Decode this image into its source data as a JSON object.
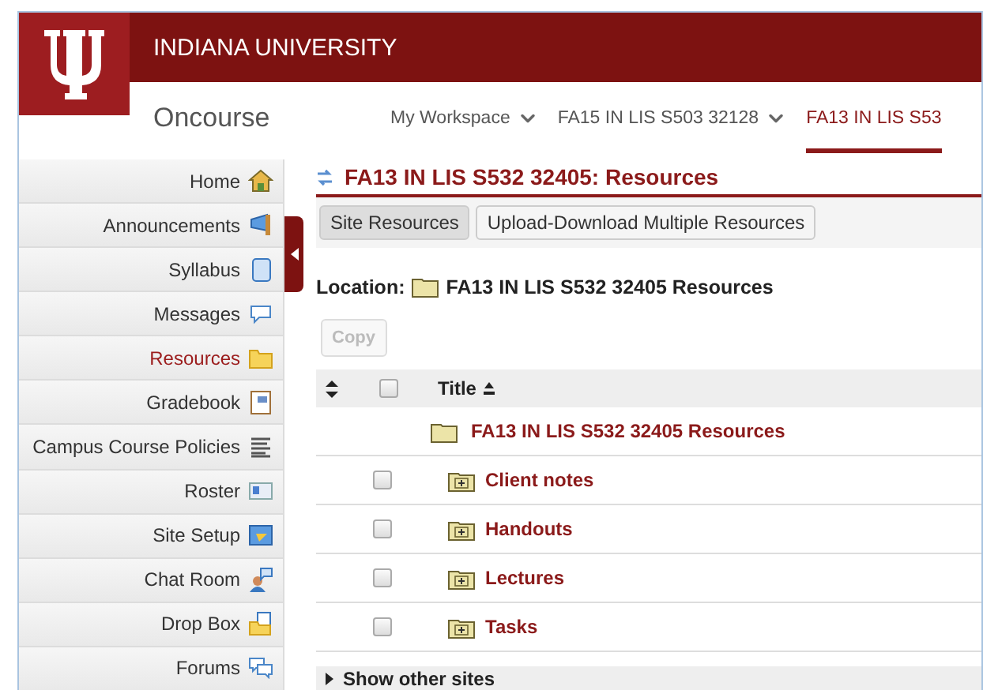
{
  "header": {
    "university": "INDIANA UNIVERSITY",
    "product": "Oncourse"
  },
  "tabs": [
    {
      "label": "My Workspace",
      "selected": false,
      "dropdown": true
    },
    {
      "label": "FA15 IN LIS S503 32128",
      "selected": false,
      "dropdown": true
    },
    {
      "label": "FA13 IN LIS S53",
      "selected": true,
      "dropdown": false
    }
  ],
  "sidebar": {
    "items": [
      {
        "label": "Home",
        "selected": false
      },
      {
        "label": "Announcements",
        "selected": false
      },
      {
        "label": "Syllabus",
        "selected": false
      },
      {
        "label": "Messages",
        "selected": false
      },
      {
        "label": "Resources",
        "selected": true
      },
      {
        "label": "Gradebook",
        "selected": false
      },
      {
        "label": "Campus Course Policies",
        "selected": false
      },
      {
        "label": "Roster",
        "selected": false
      },
      {
        "label": "Site Setup",
        "selected": false
      },
      {
        "label": "Chat Room",
        "selected": false
      },
      {
        "label": "Drop Box",
        "selected": false
      },
      {
        "label": "Forums",
        "selected": false
      }
    ]
  },
  "page_title": "FA13 IN LIS S532 32405: Resources",
  "toolbar": [
    {
      "label": "Site Resources",
      "selected": true
    },
    {
      "label": "Upload-Download Multiple Resources",
      "selected": false
    }
  ],
  "location": {
    "label": "Location:",
    "path": "FA13 IN LIS S532 32405 Resources"
  },
  "copy_button": {
    "label": "Copy",
    "disabled": true
  },
  "table": {
    "columns": [
      "Title"
    ],
    "select_all": {
      "checked": false
    },
    "root": {
      "title": "FA13 IN LIS S532 32405 Resources",
      "children": [
        {
          "title": "Client notes",
          "checked": false
        },
        {
          "title": "Handouts",
          "checked": false
        },
        {
          "title": "Lectures",
          "checked": false
        },
        {
          "title": "Tasks",
          "checked": false
        }
      ]
    }
  },
  "footer": {
    "label": "Show other sites",
    "expanded": false
  }
}
